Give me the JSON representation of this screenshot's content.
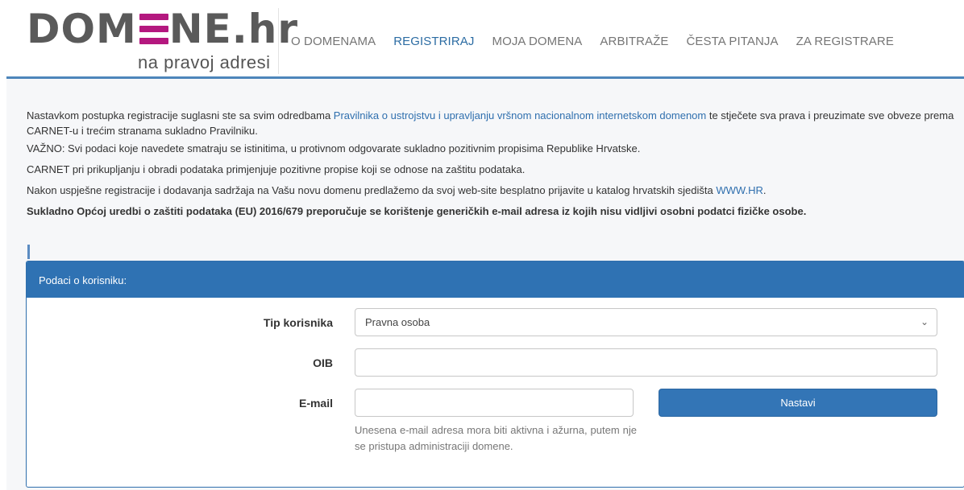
{
  "header": {
    "logo": {
      "text_before": "DOM",
      "text_after": "NE.hr",
      "tagline": "na pravoj adresi",
      "accent_color": "#b4187f"
    },
    "nav": [
      {
        "label": "O DOMENAMA",
        "active": false
      },
      {
        "label": "REGISTRIRAJ",
        "active": true
      },
      {
        "label": "MOJA DOMENA",
        "active": false
      },
      {
        "label": "ARBITRAŽE",
        "active": false
      },
      {
        "label": "ČESTA PITANJA",
        "active": false
      },
      {
        "label": "ZA REGISTRARE",
        "active": false
      }
    ]
  },
  "intro": {
    "p1_before": "Nastavkom postupka registracije suglasni ste sa svim odredbama ",
    "p1_link": "Pravilnika o ustrojstvu i upravljanju vršnom nacionalnom internetskom domenom",
    "p1_after": " te stječete sva prava i preuzimate sve obveze prema CARNET-u i trećim stranama sukladno Pravilniku.",
    "p2": "VAŽNO: Svi podaci koje navedete smatraju se istinitima, u protivnom odgovarate sukladno pozitivnim propisima Republike Hrvatske.",
    "p3": "CARNET pri prikupljanju i obradi podataka primjenjuje pozitivne propise koji se odnose na zaštitu podataka.",
    "p4_before": "Nakon uspješne registracije i dodavanja sadržaja na Vašu novu domenu predlažemo da svoj web-site besplatno prijavite u katalog hrvatskih sjedišta ",
    "p4_link": "WWW.HR",
    "p4_after": ".",
    "p5": "Sukladno Općoj uredbi o zaštiti podataka (EU) 2016/679 preporučuje se korištenje generičkih e-mail adresa iz kojih nisu vidljivi osobni podatci fizičke osobe."
  },
  "form": {
    "panel_title": "Podaci o korisniku:",
    "tip_label": "Tip korisnika",
    "tip_value": "Pravna osoba",
    "oib_label": "OIB",
    "oib_value": "",
    "email_label": "E-mail",
    "email_value": "",
    "submit_label": "Nastavi",
    "email_help": "Unesena e-mail adresa mora biti aktivna i ažurna, putem nje se pristupa administraciji domene."
  },
  "colors": {
    "primary": "#2f72b3",
    "link": "#2f6fae",
    "header_line": "#4d86bb",
    "page_bg": "#f6f7f9"
  }
}
